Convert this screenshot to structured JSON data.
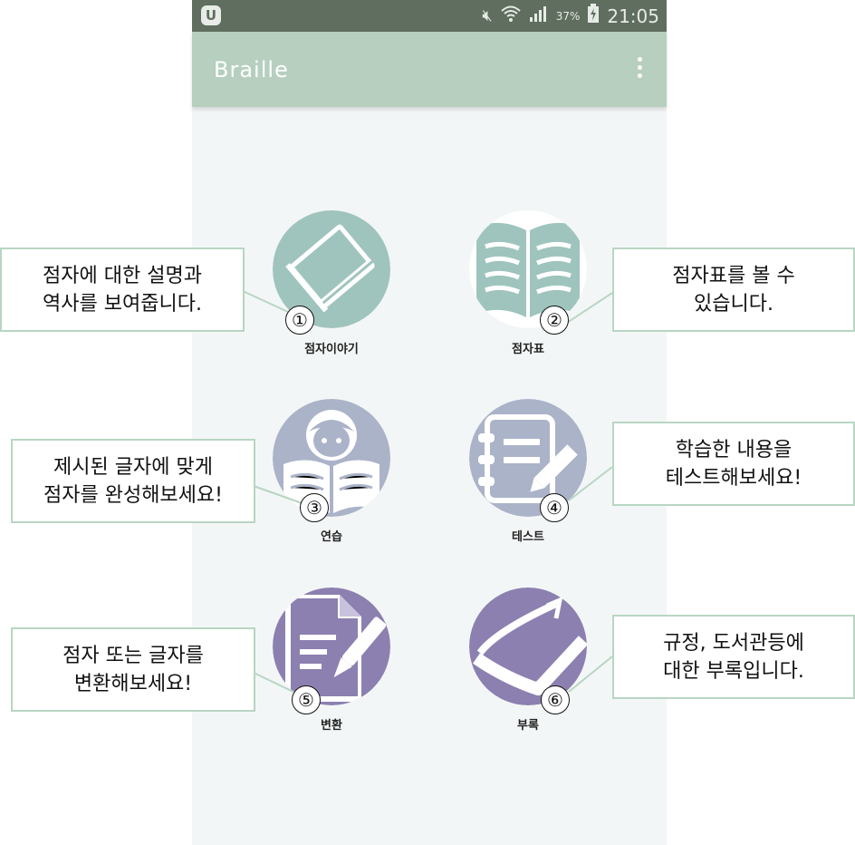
{
  "status_bar": {
    "logo": "U",
    "battery": "37%",
    "time": "21:05",
    "icons": [
      "mute-icon",
      "wifi-icon",
      "signal-icon",
      "battery-charging-icon"
    ]
  },
  "app_bar": {
    "title": "Braille",
    "menu_icon": "overflow-menu-icon"
  },
  "tiles": [
    {
      "label": "점자이야기",
      "icon": "book-icon",
      "color": "#9fc4bd"
    },
    {
      "label": "점자표",
      "icon": "open-book-icon",
      "color": "#9fc4bd"
    },
    {
      "label": "연습",
      "icon": "reading-girl-icon",
      "color": "#abb3c9"
    },
    {
      "label": "테스트",
      "icon": "notebook-pencil-icon",
      "color": "#abb3c9"
    },
    {
      "label": "변환",
      "icon": "document-pen-icon",
      "color": "#8c80b0"
    },
    {
      "label": "부록",
      "icon": "closed-book-icon",
      "color": "#8c80b0"
    }
  ],
  "callouts": [
    {
      "num": "①",
      "line1": "점자에 대한 설명과",
      "line2": "역사를 보여줍니다."
    },
    {
      "num": "②",
      "line1": "점자표를 볼 수",
      "line2": "있습니다."
    },
    {
      "num": "③",
      "line1": "제시된 글자에 맞게",
      "line2": "점자를 완성해보세요!"
    },
    {
      "num": "④",
      "line1": "학습한 내용을",
      "line2": "테스트해보세요!"
    },
    {
      "num": "⑤",
      "line1": "점자 또는 글자를",
      "line2": "변환해보세요!"
    },
    {
      "num": "⑥",
      "line1": "규정, 도서관등에",
      "line2": "대한 부록입니다."
    }
  ]
}
